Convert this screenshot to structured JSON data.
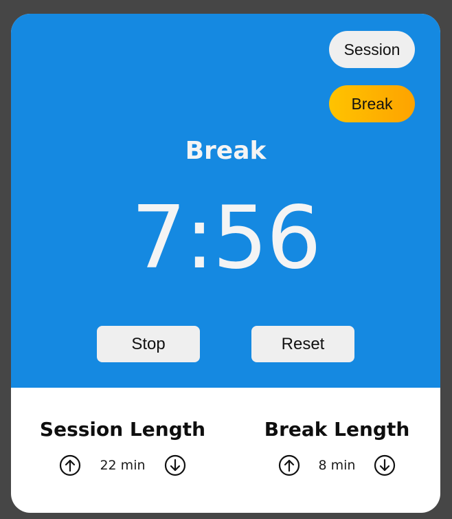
{
  "mode_toggle": {
    "session_label": "Session",
    "break_label": "Break",
    "active": "Break"
  },
  "timer": {
    "mode_title": "Break",
    "time_display": "7:56"
  },
  "controls": {
    "stop_label": "Stop",
    "reset_label": "Reset"
  },
  "session_length": {
    "title": "Session Length",
    "value": "22 min",
    "increment_icon": "arrow-up-circle-icon",
    "decrement_icon": "arrow-down-circle-icon"
  },
  "break_length": {
    "title": "Break Length",
    "value": "8 min",
    "increment_icon": "arrow-up-circle-icon",
    "decrement_icon": "arrow-down-circle-icon"
  },
  "colors": {
    "panel_blue": "#1589e1",
    "active_pill_start": "#ffc300",
    "active_pill_end": "#fea300",
    "button_gray": "#efefef",
    "background": "#464646"
  }
}
